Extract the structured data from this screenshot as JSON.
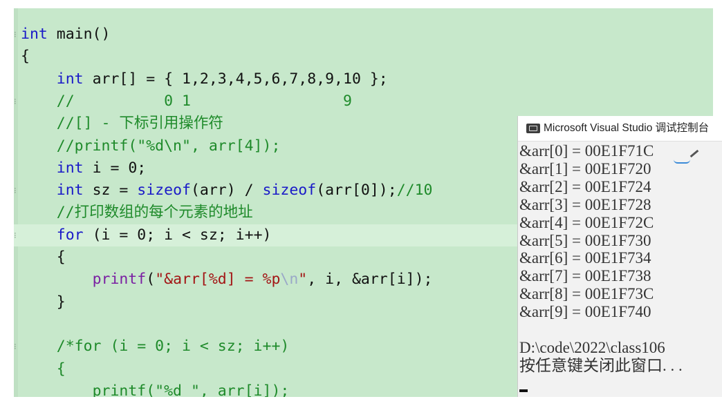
{
  "editor": {
    "lines": [
      {
        "id": "l1",
        "parts": [
          [
            "kw",
            "int"
          ],
          [
            "",
            "main()"
          ]
        ]
      },
      {
        "id": "l2",
        "parts": [
          [
            "",
            "{"
          ]
        ]
      },
      {
        "id": "l3",
        "parts": [
          [
            "",
            "    "
          ],
          [
            "kw",
            "int"
          ],
          [
            "",
            "arr[] = { 1,2,3,4,5,6,7,8,9,10 };"
          ]
        ]
      },
      {
        "id": "l4",
        "parts": [
          [
            "",
            "    "
          ],
          [
            "com",
            "//          0 1                 9"
          ]
        ]
      },
      {
        "id": "l5",
        "parts": [
          [
            "",
            "    "
          ],
          [
            "com",
            "//[] - 下标引用操作符"
          ]
        ]
      },
      {
        "id": "l6",
        "parts": [
          [
            "",
            "    "
          ],
          [
            "com",
            "//printf(\"%d\\n\", arr[4]);"
          ]
        ]
      },
      {
        "id": "l7",
        "parts": [
          [
            "",
            "    "
          ],
          [
            "kw",
            "int"
          ],
          [
            "",
            " i = 0;"
          ]
        ]
      },
      {
        "id": "l8",
        "parts": [
          [
            "",
            "    "
          ],
          [
            "kw",
            "int"
          ],
          [
            "",
            " sz = "
          ],
          [
            "kw",
            "sizeof"
          ],
          [
            "",
            "(arr) / "
          ],
          [
            "kw",
            "sizeof"
          ],
          [
            "",
            "(arr[0]);"
          ],
          [
            "com",
            "//10"
          ]
        ]
      },
      {
        "id": "l9",
        "parts": [
          [
            "",
            "    "
          ],
          [
            "com",
            "//打印数组的每个元素的地址"
          ]
        ]
      },
      {
        "id": "l10",
        "parts": [
          [
            "",
            "    "
          ],
          [
            "kw",
            "for"
          ],
          [
            "",
            " (i = 0; i < sz; i++)"
          ]
        ]
      },
      {
        "id": "l11",
        "parts": [
          [
            "",
            "    {"
          ]
        ]
      },
      {
        "id": "l12",
        "parts": [
          [
            "",
            "        "
          ],
          [
            "fn",
            "printf"
          ],
          [
            "",
            "("
          ],
          [
            "str",
            "\"&arr[%d] = %p"
          ],
          [
            "esc",
            "\\n"
          ],
          [
            "str",
            "\""
          ],
          [
            "",
            ", i, &arr[i]);"
          ]
        ]
      },
      {
        "id": "l13",
        "parts": [
          [
            "",
            "    }"
          ]
        ]
      },
      {
        "id": "l14",
        "parts": [
          [
            "",
            ""
          ]
        ]
      },
      {
        "id": "l15",
        "parts": [
          [
            "",
            "    "
          ],
          [
            "com",
            "/*for (i = 0; i < sz; i++)"
          ]
        ]
      },
      {
        "id": "l16",
        "parts": [
          [
            "",
            "    "
          ],
          [
            "com",
            "{"
          ]
        ]
      },
      {
        "id": "l17",
        "parts": [
          [
            "",
            "        "
          ],
          [
            "com",
            "printf(\"%d \", arr[i]);"
          ]
        ]
      }
    ],
    "current_line": 10
  },
  "console": {
    "title": "Microsoft Visual Studio 调试控制台",
    "icon": "vs-debug-console-icon",
    "output": [
      "&arr[0] = 00E1F71C",
      "&arr[1] = 00E1F720",
      "&arr[2] = 00E1F724",
      "&arr[3] = 00E1F728",
      "&arr[4] = 00E1F72C",
      "&arr[5] = 00E1F730",
      "&arr[6] = 00E1F734",
      "&arr[7] = 00E1F738",
      "&arr[8] = 00E1F73C",
      "&arr[9] = 00E1F740",
      "",
      "D:\\code\\2022\\class106",
      "按任意键关闭此窗口. . ."
    ]
  },
  "colors": {
    "editor_bg": "#c7e8cb",
    "keyword": "#1a1ac8",
    "comment": "#1e8a2a",
    "string": "#a31515",
    "function": "#7a1fa2",
    "console_bg": "#f2f2f2"
  }
}
